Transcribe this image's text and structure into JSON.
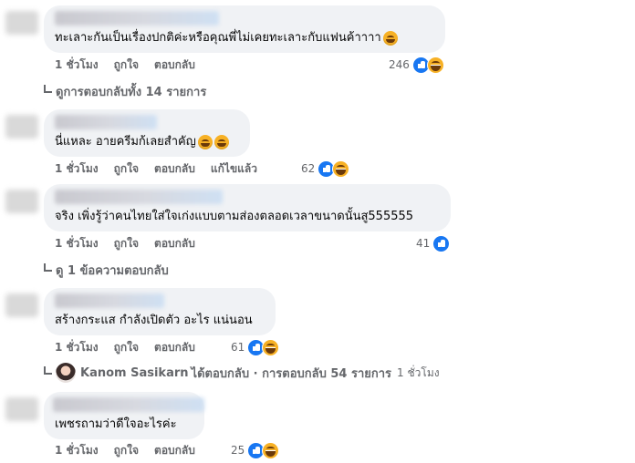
{
  "comments": [
    {
      "text": "ทะเลาะกันเป็นเรื่องปกติค่ะหรือคุณพี่ไม่เคยทะเลาะกับแฟนค้าาาา",
      "emojis": [
        "rofl"
      ],
      "time": "1 ชั่วโมง",
      "like": "ถูกใจ",
      "reply": "ตอบกลับ",
      "edited": "",
      "reaction_count": "246",
      "reactions": [
        "like",
        "haha"
      ]
    },
    {
      "text": "นี่แหละ อายครีมก้เลยสำคัญ",
      "emojis": [
        "rofl",
        "rofl"
      ],
      "time": "1 ชั่วโมง",
      "like": "ถูกใจ",
      "reply": "ตอบกลับ",
      "edited": "แก้ไขแล้ว",
      "reaction_count": "62",
      "reactions": [
        "like",
        "haha"
      ]
    },
    {
      "text": "จริง เพิ่งรู้ว่าคนไทยใส่ใจเก่งแบบตามส่องตลอดเวลาขนาดนั้นสู555555",
      "emojis": [],
      "time": "1 ชั่วโมง",
      "like": "ถูกใจ",
      "reply": "ตอบกลับ",
      "edited": "",
      "reaction_count": "41",
      "reactions": [
        "like"
      ]
    },
    {
      "text": "สร้างกระแส กำลังเปิดตัว อะไร แน่นอน",
      "emojis": [],
      "time": "1 ชั่วโมง",
      "like": "ถูกใจ",
      "reply": "ตอบกลับ",
      "edited": "",
      "reaction_count": "61",
      "reactions": [
        "like",
        "haha"
      ]
    },
    {
      "text": "เพชรถามว่าดีใจอะไรค่ะ",
      "emojis": [],
      "time": "1 ชั่วโมง",
      "like": "ถูกใจ",
      "reply": "ตอบกลับ",
      "edited": "",
      "reaction_count": "25",
      "reactions": [
        "like",
        "haha"
      ]
    }
  ],
  "view_replies": [
    "ดูการตอบกลับทั้ง 14 รายการ",
    "ดู 1 ข้อความตอบกลับ"
  ],
  "reply_summary": {
    "name": "Kanom Sasikarn",
    "action": "ได้ตอบกลับ · การตอบกลับ 54 รายการ",
    "time": "1 ชั่วโมง"
  },
  "colors": {
    "bubble": "#f0f2f5",
    "meta": "#65676b",
    "like_blue": "#1877f2",
    "haha_yellow": "#f7b125"
  }
}
